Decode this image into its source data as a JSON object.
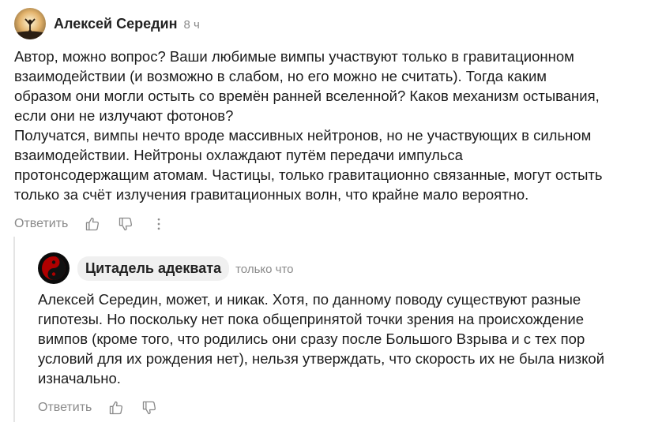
{
  "comments": [
    {
      "author": "Алексей Середин",
      "time": "8 ч",
      "text": "Автор, можно вопрос? Ваши любимые вимпы участвуют только в гравитационном\nвзаимодействии (и возможно в слабом, но его можно не считать). Тогда каким\nобразом они могли остыть со времён ранней вселенной? Каков механизм остывания,\nесли они не излучают фотонов?\nПолучатся, вимпы нечто вроде массивных нейтронов, но не участвующих в сильном\nвзаимодействии. Нейтроны охлаждают путём передачи импульса\nпротонсодержащим атомам. Частицы, только гравитационно связанные, могут остыть\nтолько за счёт излучения гравитационных волн, что крайне мало вероятно.",
      "reply_label": "Ответить"
    },
    {
      "author": "Цитадель адеквата",
      "time": "только что",
      "text": "Алексей Середин, может, и никак. Хотя, по данному поводу существуют разные\nгипотезы. Но поскольку нет пока общепринятой точки зрения на происхождение\nвимпов (кроме того, что родились они сразу после Большого Взрыва и с тех пор\nусловий для их рождения нет), нельзя утверждать, что скорость их не была низкой\nизначально.",
      "reply_label": "Ответить"
    }
  ]
}
